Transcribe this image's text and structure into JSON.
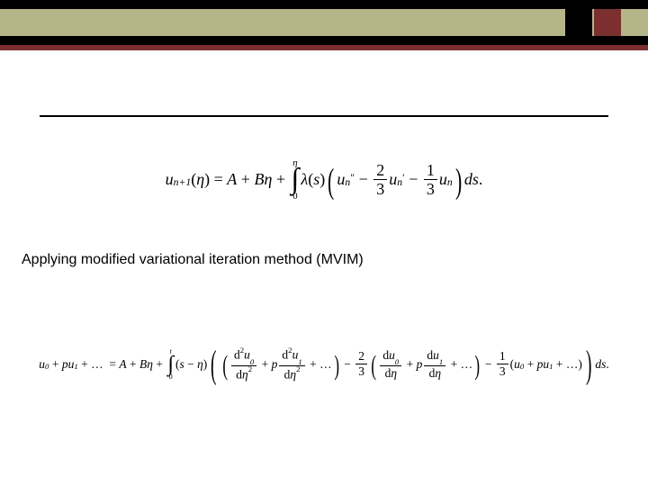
{
  "caption": "Applying modified variational iteration method (MVIM)",
  "eq1": {
    "lhs_var": "u",
    "lhs_sub": "n+1",
    "lhs_arg": "η",
    "A": "A",
    "B": "B",
    "eta": "η",
    "int_upper": "η",
    "int_lower": "0",
    "lambda": "λ",
    "lambda_arg": "s",
    "u": "u",
    "sub_n": "n",
    "c1_num": "2",
    "c1_den": "3",
    "c2_num": "1",
    "c2_den": "3",
    "ds": "ds",
    "dot": "."
  },
  "eq2": {
    "u": "u",
    "s0": "0",
    "p": "p",
    "s1": "1",
    "ell": "…",
    "A": "A",
    "B": "B",
    "eta": "η",
    "int_upper": "t",
    "int_lower": "0",
    "s": "s",
    "d2": "d",
    "sq": "2",
    "deta": "dη",
    "c1_num": "2",
    "c1_den": "3",
    "c2_num": "1",
    "c2_den": "3",
    "ds": "ds",
    "dot": "."
  }
}
